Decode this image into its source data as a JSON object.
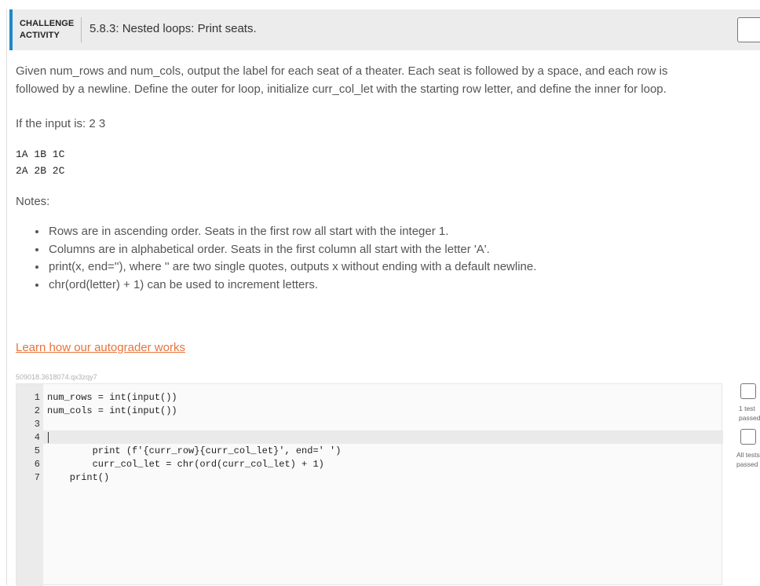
{
  "header": {
    "label_line1": "CHALLENGE",
    "label_line2": "ACTIVITY",
    "title": "5.8.3: Nested loops: Print seats."
  },
  "description": "Given num_rows and num_cols, output the label for each seat of a theater. Each seat is followed by a space, and each row is followed by a newline. Define the outer for loop, initialize curr_col_let with the starting row letter, and define the inner for loop.",
  "input_label": "If the input is: 2 3",
  "example_output": [
    "1A 1B 1C",
    "2A 2B 2C"
  ],
  "notes_label": "Notes:",
  "notes": [
    "Rows are in ascending order. Seats in the first row all start with the integer 1.",
    "Columns are in alphabetical order. Seats in the first column all start with the letter 'A'.",
    "print(x, end=''), where '' are two single quotes, outputs x without ending with a default newline.",
    "chr(ord(letter) + 1) can be used to increment letters."
  ],
  "autograder_link": "Learn how our autograder works",
  "activity_id": "509018.3618074.qx3zqy7",
  "code": {
    "line_numbers": [
      "1",
      "2",
      "3",
      "4",
      "5",
      "6",
      "7"
    ],
    "lines": [
      "num_rows = int(input())",
      "num_cols = int(input())",
      "",
      "",
      "        print (f'{curr_row}{curr_col_let}', end=' ')",
      "        curr_col_let = chr(ord(curr_col_let) + 1)",
      "    print()"
    ]
  },
  "status": {
    "test1_line1": "1 test",
    "test1_line2": "passed",
    "test2_line1": "All tests",
    "test2_line2": "passed"
  }
}
